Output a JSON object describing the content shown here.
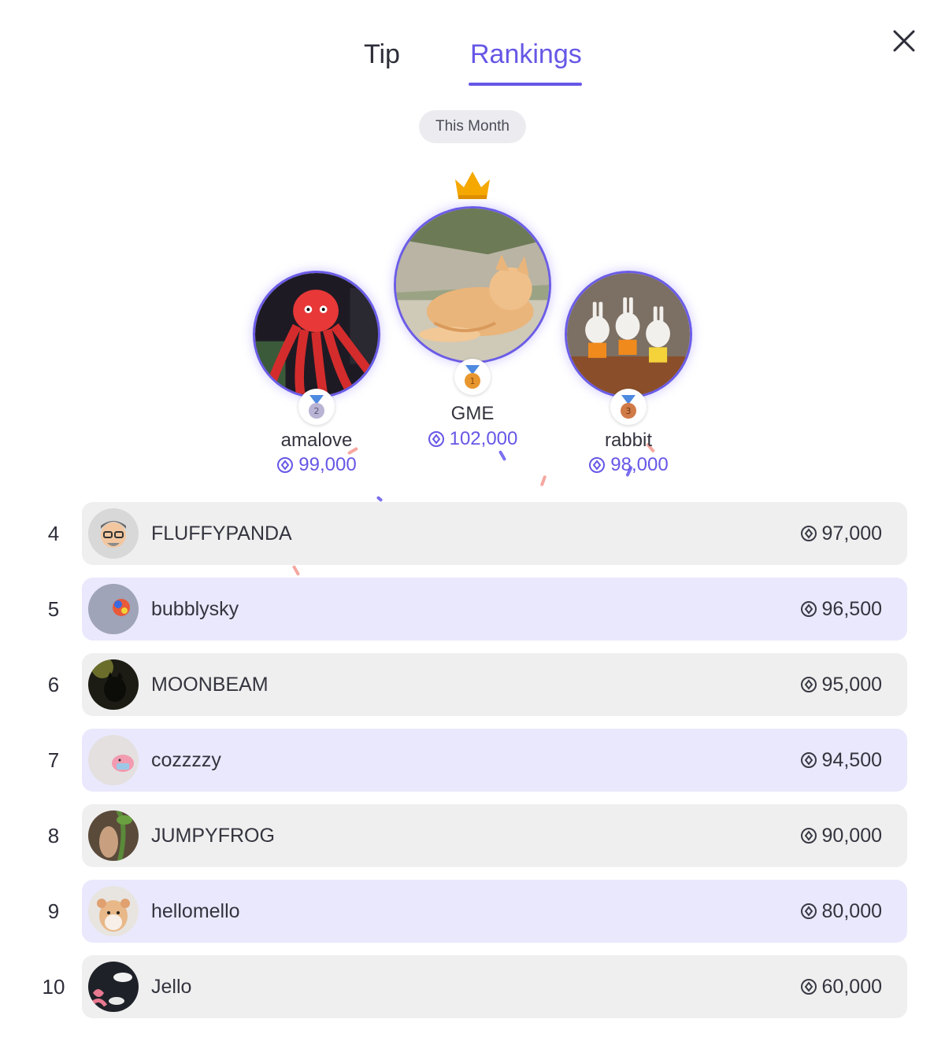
{
  "tabs": [
    {
      "label": "Tip",
      "active": false
    },
    {
      "label": "Rankings",
      "active": true
    }
  ],
  "period": {
    "label": "This Month"
  },
  "podium": {
    "first": {
      "rank": 1,
      "name": "GME",
      "score": "102,000",
      "medal_color": "#e8962e"
    },
    "second": {
      "rank": 2,
      "name": "amalove",
      "score": "99,000",
      "medal_color": "#b9b3d4"
    },
    "third": {
      "rank": 3,
      "name": "rabbit",
      "score": "98,000",
      "medal_color": "#d07a48"
    }
  },
  "rankings": [
    {
      "rank": "4",
      "name": "FLUFFYPANDA",
      "score": "97,000"
    },
    {
      "rank": "5",
      "name": "bubblysky",
      "score": "96,500"
    },
    {
      "rank": "6",
      "name": "MOONBEAM",
      "score": "95,000"
    },
    {
      "rank": "7",
      "name": "cozzzzy",
      "score": "94,500"
    },
    {
      "rank": "8",
      "name": "JUMPYFROG",
      "score": "90,000"
    },
    {
      "rank": "9",
      "name": "hellomello",
      "score": "80,000"
    },
    {
      "rank": "10",
      "name": "Jello",
      "score": "60,000"
    }
  ],
  "colors": {
    "accent": "#6657e6",
    "row_gray": "#efefef",
    "row_purple": "#eae8fc",
    "crown": "#f5a800"
  },
  "icons": {
    "close": "close-icon",
    "coin": "coin-icon",
    "crown": "crown-icon",
    "medal": "medal-icon"
  }
}
